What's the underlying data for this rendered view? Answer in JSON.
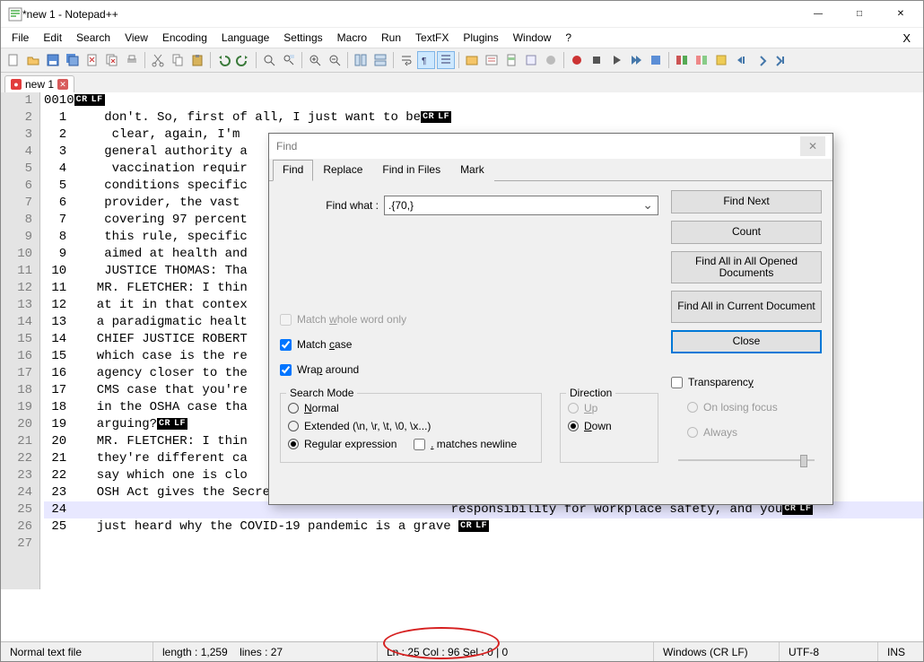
{
  "window": {
    "title": "*new 1 - Notepad++"
  },
  "menu": [
    "File",
    "Edit",
    "Search",
    "View",
    "Encoding",
    "Language",
    "Settings",
    "Macro",
    "Run",
    "TextFX",
    "Plugins",
    "Window",
    "?"
  ],
  "tab": {
    "name": "new 1"
  },
  "gutter": [
    1,
    2,
    3,
    4,
    5,
    6,
    7,
    8,
    9,
    10,
    11,
    12,
    13,
    14,
    15,
    16,
    17,
    18,
    19,
    20,
    21,
    22,
    23,
    24,
    25,
    26,
    27
  ],
  "lines": [
    "0010",
    "  1     don't. So, first of all, I just want to be",
    "  2      clear, again, I'm ",
    "  3     general authority a",
    "  4      vaccination requir",
    "  5     conditions specific",
    "  6     provider, the vast ",
    "  7     covering 97 percent",
    "  8     this rule, specific",
    "  9     aimed at health and",
    " 10     JUSTICE THOMAS: Tha",
    " 11    MR. FLETCHER: I thin",
    " 12    at it in that contex",
    " 13    a paradigmatic healt",
    " 14    CHIEF JUSTICE ROBERT",
    " 15    which case is the re",
    " 16    agency closer to the",
    " 17    CMS case that you're",
    " 18    in the OSHA case tha",
    " 19    arguing?",
    " 20    MR. FLETCHER: I thin",
    " 21    they're different ca",
    " 22    say which one is clo",
    " 23    OSH Act gives the Secretary of Labor",
    " 24                                                   responsibility for workplace safety, and you",
    " 25    just heard why the COVID-19 pandemic is a grave ",
    ""
  ],
  "find": {
    "title": "Find",
    "tabs": [
      "Find",
      "Replace",
      "Find in Files",
      "Mark"
    ],
    "findwhat_label": "Find what :",
    "findwhat_value": ".{70,}",
    "match_whole": "Match whole word only",
    "match_case": "Match case",
    "wrap": "Wrap around",
    "search_mode": "Search Mode",
    "normal": "Normal",
    "extended": "Extended (\\n, \\r, \\t, \\0, \\x...)",
    "regex": "Regular expression",
    "dotmatch": ". matches newline",
    "direction": "Direction",
    "up": "Up",
    "down": "Down",
    "transparency": "Transparency",
    "onlosing": "On losing focus",
    "always": "Always",
    "btn_next": "Find Next",
    "btn_count": "Count",
    "btn_allopen": "Find All in All Opened Documents",
    "btn_allcur": "Find All in Current Document",
    "btn_close": "Close"
  },
  "status": {
    "type": "Normal text file",
    "length": "length : 1,259",
    "lines": "lines : 27",
    "pos": "Ln : 25    Col : 96    Sel : 0 | 0",
    "eol": "Windows (CR LF)",
    "enc": "UTF-8",
    "ins": "INS"
  }
}
